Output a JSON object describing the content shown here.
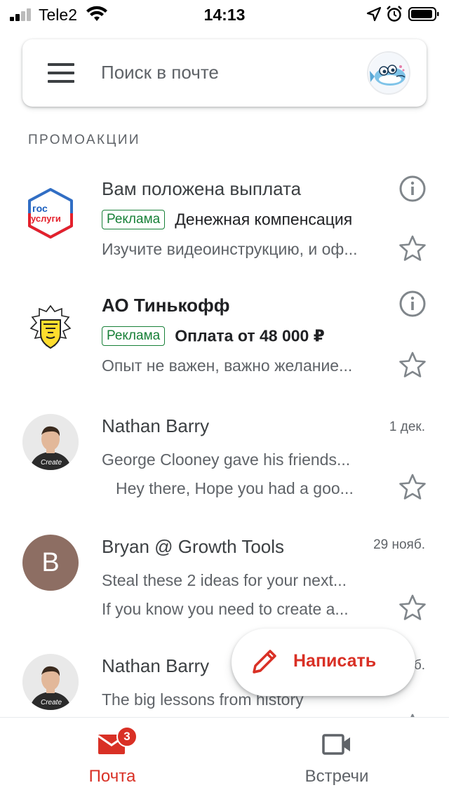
{
  "status_bar": {
    "carrier": "Tele2",
    "time": "14:13"
  },
  "search": {
    "placeholder": "Поиск в почте"
  },
  "section": {
    "label": "ПРОМОАКЦИИ"
  },
  "mails": [
    {
      "sender": "Вам положена выплата",
      "ad_label": "Реклама",
      "subject": "Денежная компенсация",
      "snippet": "Изучите видеоинструкцию, и оф...",
      "logo_text_top": "гос",
      "logo_text_bottom": "услуги"
    },
    {
      "sender": "АО Тинькофф",
      "ad_label": "Реклама",
      "subject": "Оплата от 48 000 ₽",
      "snippet": "Опыт не важен, важно желание..."
    },
    {
      "sender": "Nathan Barry",
      "date": "1 дек.",
      "subject": "George Clooney gave his friends...",
      "snippet": "Hey there, Hope you had a goo..."
    },
    {
      "sender": "Bryan @ Growth Tools",
      "avatar_letter": "B",
      "date": "29 нояб.",
      "subject": "Steal these 2 ideas for your next...",
      "snippet": "If you know you need to create a..."
    },
    {
      "sender": "Nathan Barry",
      "date": "б.",
      "subject": "The big lessons from history"
    }
  ],
  "compose": {
    "label": "Написать"
  },
  "bottom_nav": {
    "mail_label": "Почта",
    "mail_badge": "3",
    "meet_label": "Встречи"
  },
  "colors": {
    "accent_red": "#d93025",
    "ad_green": "#188038",
    "avatar_b": "#8d6e63"
  }
}
